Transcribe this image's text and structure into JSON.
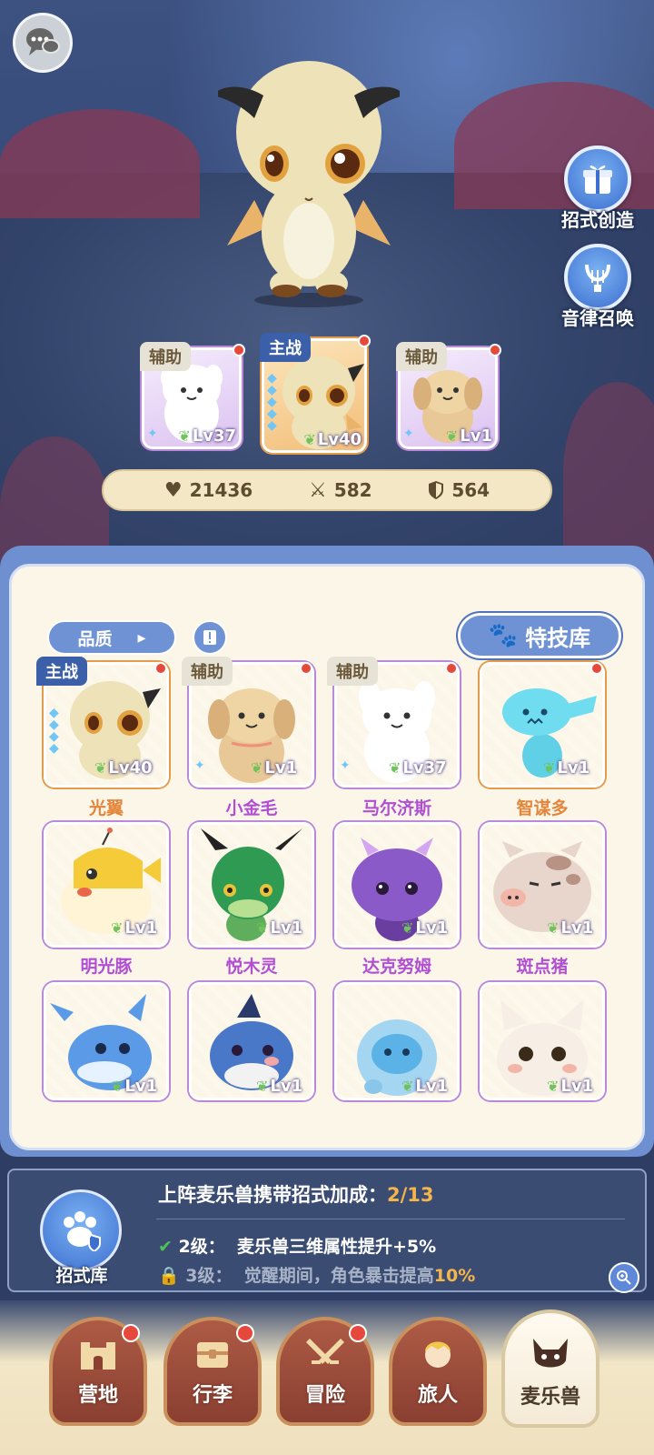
{
  "side_buttons": {
    "move_create": "招式创造",
    "rhythm_summon": "音律召唤"
  },
  "team": {
    "slots": [
      {
        "tag": "辅助",
        "level": "Lv37",
        "pet": "马尔济斯"
      },
      {
        "tag": "主战",
        "level": "Lv40",
        "pet": "光翼"
      },
      {
        "tag": "辅助",
        "level": "Lv1",
        "pet": "小金毛"
      }
    ]
  },
  "stats": {
    "hp": "21436",
    "attack": "582",
    "defense": "564"
  },
  "panel": {
    "quality_filter": "品质",
    "skill_library": "特技库"
  },
  "pets": [
    {
      "name": "光翼",
      "level": "Lv40",
      "tag": "主战",
      "rarity": "gold"
    },
    {
      "name": "小金毛",
      "level": "Lv1",
      "tag": "辅助",
      "rarity": "purple"
    },
    {
      "name": "马尔济斯",
      "level": "Lv37",
      "tag": "辅助",
      "rarity": "purple"
    },
    {
      "name": "智谋多",
      "level": "Lv1",
      "tag": "",
      "rarity": "gold"
    },
    {
      "name": "明光豚",
      "level": "Lv1",
      "tag": "",
      "rarity": "purple"
    },
    {
      "name": "悦木灵",
      "level": "Lv1",
      "tag": "",
      "rarity": "purple"
    },
    {
      "name": "达克努姆",
      "level": "Lv1",
      "tag": "",
      "rarity": "purple"
    },
    {
      "name": "斑点猪",
      "level": "Lv1",
      "tag": "",
      "rarity": "purple"
    },
    {
      "name": "",
      "level": "Lv1",
      "tag": "",
      "rarity": "purple"
    },
    {
      "name": "",
      "level": "Lv1",
      "tag": "",
      "rarity": "purple"
    },
    {
      "name": "",
      "level": "Lv1",
      "tag": "",
      "rarity": "purple"
    },
    {
      "name": "",
      "level": "Lv1",
      "tag": "",
      "rarity": "purple"
    }
  ],
  "bonus": {
    "library_label": "招式库",
    "title": "上阵麦乐兽携带招式加成：",
    "progress": "2/13",
    "line1_level": "2级：",
    "line1_text": "麦乐兽三维属性提升+5%",
    "line2_level": "3级：",
    "line2_text": "觉醒期间，角色暴击提高",
    "line2_pct": "10%"
  },
  "nav": {
    "tabs": [
      "营地",
      "行李",
      "冒险",
      "旅人",
      "麦乐兽"
    ],
    "active_index": 4
  },
  "colors": {
    "accent_blue": "#6f92d4",
    "gold_name": "#e3863b",
    "purple_name": "#b04fd4",
    "bonus_highlight": "#f4b64b",
    "red_dot": "#e6493c"
  }
}
